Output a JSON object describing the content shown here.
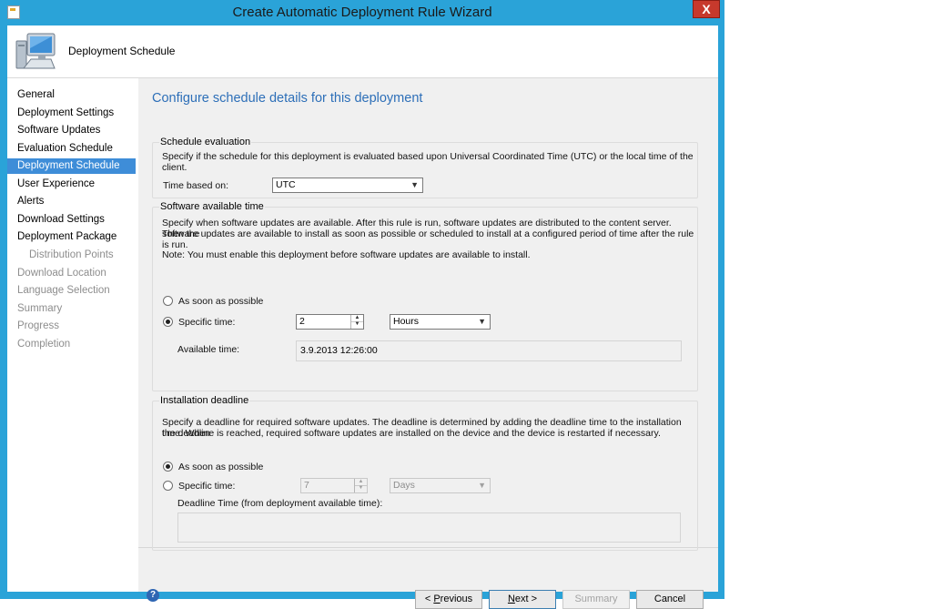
{
  "window": {
    "title": "Create Automatic Deployment Rule Wizard",
    "close_label": "X"
  },
  "header": {
    "title": "Deployment Schedule",
    "icon": "computer-icon"
  },
  "nav": {
    "items": [
      {
        "label": "General",
        "state": "normal"
      },
      {
        "label": "Deployment Settings",
        "state": "normal"
      },
      {
        "label": "Software Updates",
        "state": "normal"
      },
      {
        "label": "Evaluation Schedule",
        "state": "normal"
      },
      {
        "label": "Deployment Schedule",
        "state": "active"
      },
      {
        "label": "User Experience",
        "state": "normal"
      },
      {
        "label": "Alerts",
        "state": "normal"
      },
      {
        "label": "Download Settings",
        "state": "normal"
      },
      {
        "label": "Deployment Package",
        "state": "normal"
      },
      {
        "label": "Distribution Points",
        "state": "disabled"
      },
      {
        "label": "Download Location",
        "state": "disabled"
      },
      {
        "label": "Language Selection",
        "state": "disabled"
      },
      {
        "label": "Summary",
        "state": "disabled"
      },
      {
        "label": "Progress",
        "state": "disabled"
      },
      {
        "label": "Completion",
        "state": "disabled"
      }
    ]
  },
  "main": {
    "heading": "Configure schedule details for this deployment",
    "schedule_evaluation": {
      "title": "Schedule evaluation",
      "description": "Specify if the schedule for this deployment is evaluated based upon Universal Coordinated Time (UTC) or the local time of the client.",
      "time_based_on_label": "Time based on:",
      "time_based_on_value": "UTC"
    },
    "software_available": {
      "title": "Software available time",
      "description_1": "Specify when software updates are available. After this rule is run, software updates are distributed to the content server. Then the",
      "description_2": "software updates are available to install as soon as possible or scheduled to install at a configured period of time after the rule is run.",
      "note": "Note: You must enable this deployment before software updates are available to install.",
      "asap_label": "As soon as possible",
      "asap_checked": false,
      "specific_label": "Specific time:",
      "specific_checked": true,
      "specific_value": "2",
      "unit_value": "Hours",
      "available_time_label": "Available time:",
      "available_time_value": "3.9.2013 12:26:00"
    },
    "installation_deadline": {
      "title": "Installation deadline",
      "description_1": "Specify a deadline for required software updates. The deadline is determined by adding the deadline time to the installation time. When",
      "description_2": "the deadline is reached, required software updates are installed on the device and the device is restarted if necessary.",
      "asap_label": "As soon as possible",
      "asap_checked": true,
      "specific_label": "Specific time:",
      "specific_checked": false,
      "specific_value": "7",
      "unit_value": "Days",
      "deadline_time_label": "Deadline Time (from deployment available time):",
      "deadline_time_value": ""
    }
  },
  "footer": {
    "previous_prefix": "< ",
    "previous_accel": "P",
    "previous_rest": "revious",
    "next_accel": "N",
    "next_rest": "ext >",
    "summary_label": "Summary",
    "cancel_label": "Cancel",
    "help_label": "?"
  }
}
